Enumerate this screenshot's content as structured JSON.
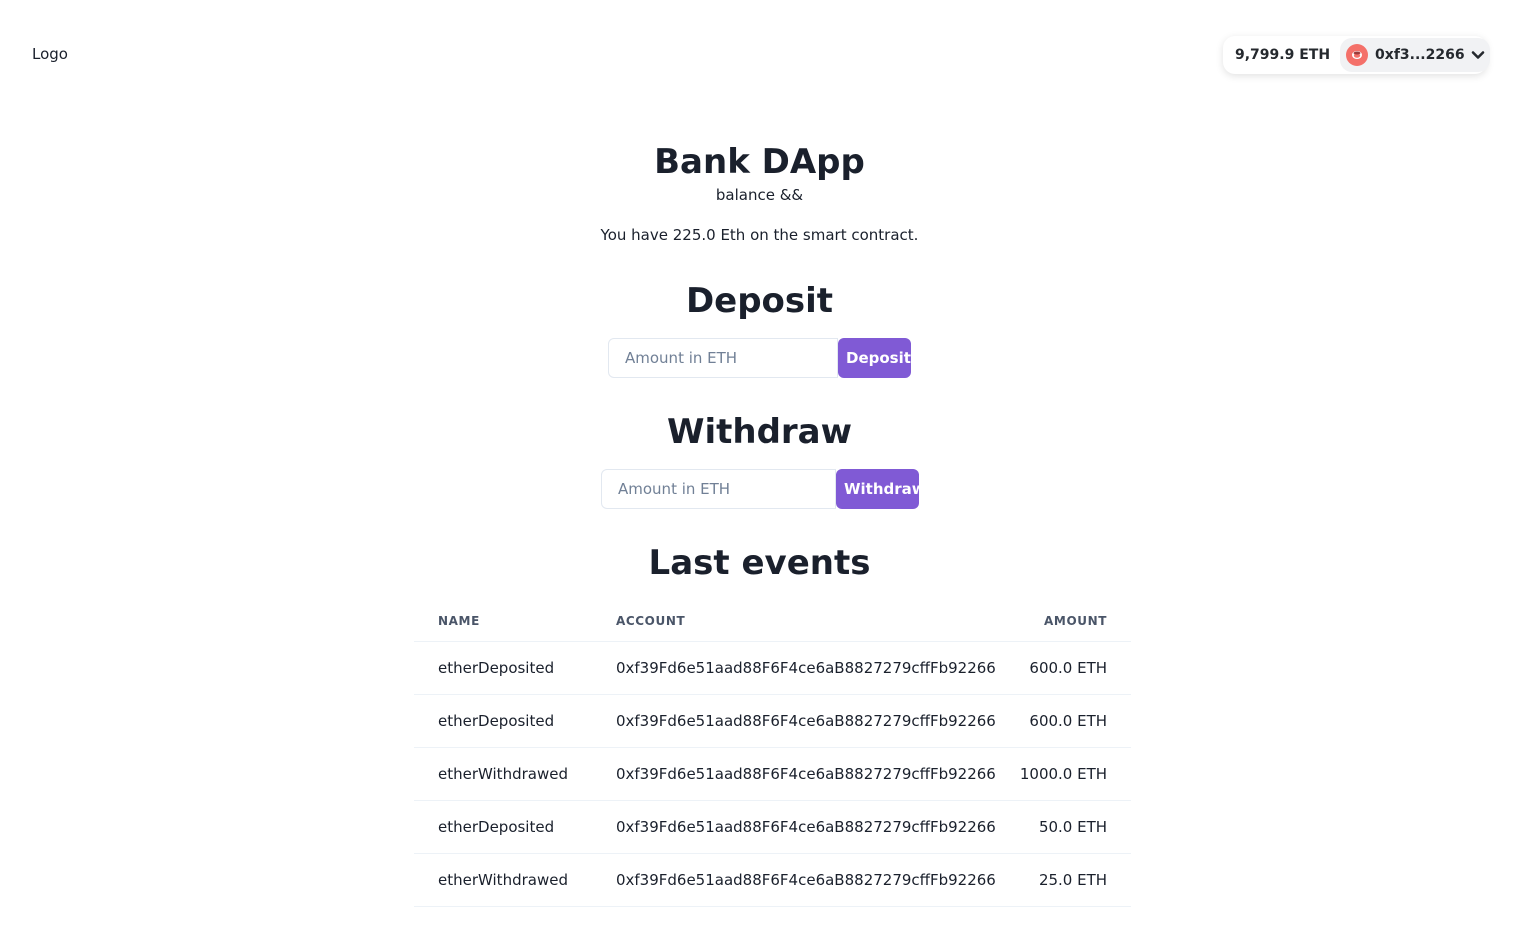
{
  "header": {
    "logo_text": "Logo",
    "wallet": {
      "balance": "9,799.9 ETH",
      "address": "0xf3...2266",
      "avatar_icon": "wallet-avatar-icon",
      "avatar_color": "#f47069"
    }
  },
  "main": {
    "title": "Bank DApp",
    "subtitle": "balance &&",
    "balance_text": "You have 225.0 Eth on the smart contract.",
    "deposit": {
      "heading": "Deposit",
      "input_placeholder": "Amount in ETH",
      "button_label": "Deposit"
    },
    "withdraw": {
      "heading": "Withdraw",
      "input_placeholder": "Amount in ETH",
      "button_label": "Withdraw"
    },
    "events": {
      "heading": "Last events",
      "columns": [
        "Name",
        "Account",
        "Amount"
      ],
      "rows": [
        {
          "name": "etherDeposited",
          "account": "0xf39Fd6e51aad88F6F4ce6aB8827279cffFb92266",
          "amount": "600.0 ETH"
        },
        {
          "name": "etherDeposited",
          "account": "0xf39Fd6e51aad88F6F4ce6aB8827279cffFb92266",
          "amount": "600.0 ETH"
        },
        {
          "name": "etherWithdrawed",
          "account": "0xf39Fd6e51aad88F6F4ce6aB8827279cffFb92266",
          "amount": "1000.0 ETH"
        },
        {
          "name": "etherDeposited",
          "account": "0xf39Fd6e51aad88F6F4ce6aB8827279cffFb92266",
          "amount": "50.0 ETH"
        },
        {
          "name": "etherWithdrawed",
          "account": "0xf39Fd6e51aad88F6F4ce6aB8827279cffFb92266",
          "amount": "25.0 ETH"
        }
      ]
    }
  },
  "colors": {
    "accent": "#805ad5",
    "text": "#1a202c",
    "muted": "#718096"
  }
}
